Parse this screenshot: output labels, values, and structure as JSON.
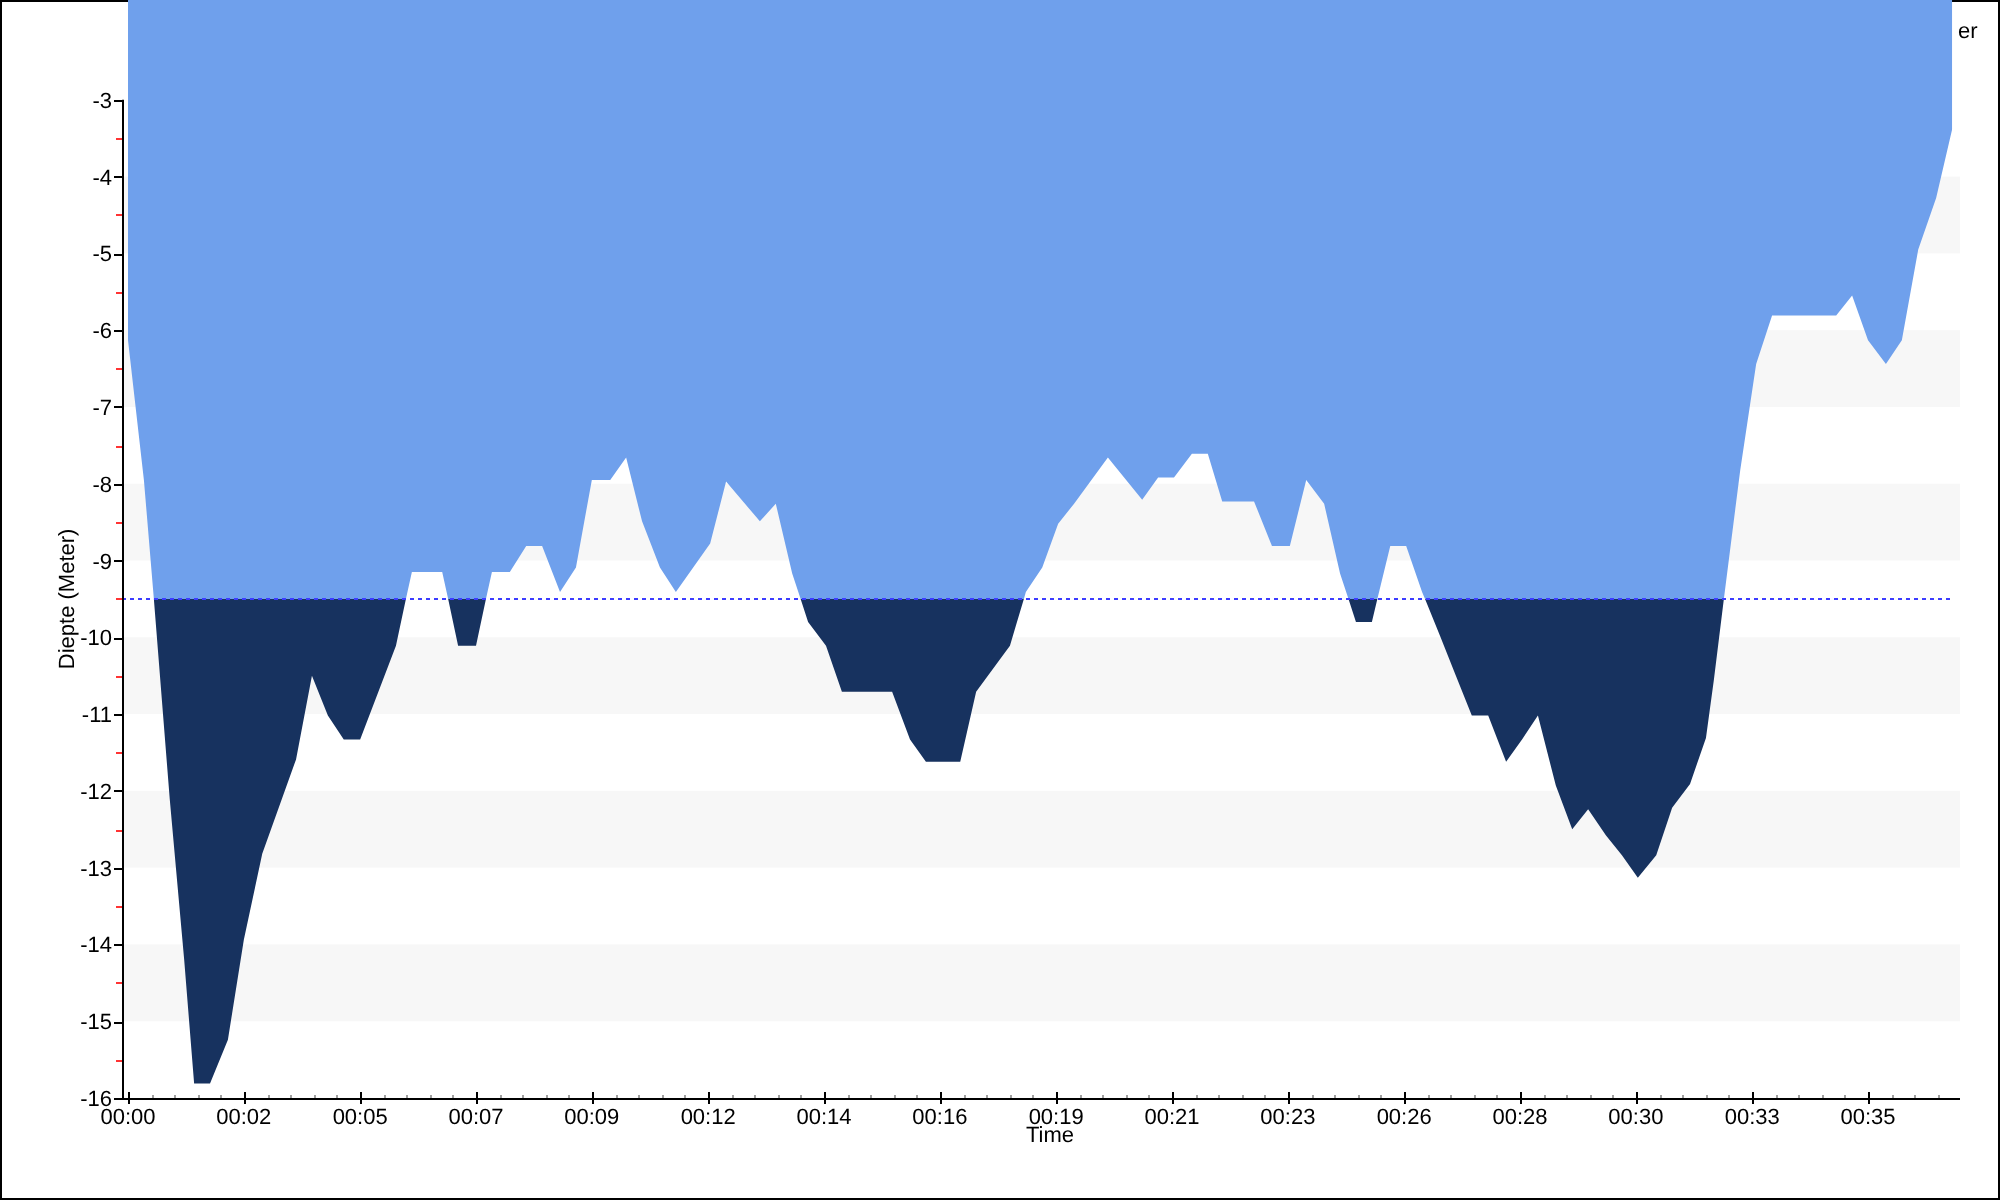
{
  "chart": {
    "legend_label": "er",
    "chart_data": {
      "type": "area",
      "xlabel": "Time",
      "ylabel": "Diepte (Meter)",
      "x": [
        0,
        0.32,
        0.52,
        0.84,
        1.13,
        1.33,
        1.65,
        2.01,
        2.33,
        2.7,
        3.38,
        3.7,
        4.02,
        4.34,
        4.67,
        5.39,
        5.59,
        5.71,
        6.32,
        6.44,
        6.64,
        7,
        7.2,
        7.32,
        7.68,
        8.01,
        8.33,
        8.69,
        9.01,
        9.33,
        9.7,
        10.02,
        10.34,
        10.7,
        11.02,
        11.71,
        12.03,
        12.71,
        13.03,
        13.36,
        13.53,
        13.68,
        14.04,
        14.36,
        15.37,
        15.73,
        16.05,
        16.74,
        17.06,
        17.74,
        18.02,
        18.06,
        18.39,
        18.71,
        19.03,
        19.71,
        20.4,
        20.72,
        21.04,
        21.4,
        21.72,
        22.01,
        22.65,
        23.01,
        23.37,
        23.7,
        24.06,
        24.38,
        24.55,
        24.7,
        25.02,
        25.13,
        25.39,
        25.71,
        26.03,
        26.09,
        26.39,
        26.71,
        27.03,
        27.36,
        27.72,
        28.04,
        28.36,
        28.72,
        29.05,
        29.37,
        29.73,
        30.05,
        30.37,
        30.74,
        31.06,
        31.42,
        31.74,
        31.9,
        32.1,
        32.43,
        32.75,
        33.07,
        34.36,
        34.68,
        35,
        35.36,
        35.68,
        36.01,
        36.37,
        36.69
      ],
      "series": [
        {
          "color": "#6fa0ec",
          "values": [
            -6.13,
            -7.95,
            -9.5,
            -9.5,
            -9.5,
            -9.5,
            -9.5,
            -9.5,
            -9.5,
            -9.5,
            -9.5,
            -9.5,
            -9.5,
            -9.5,
            -9.5,
            -9.5,
            -9.5,
            -9.15,
            -9.15,
            -9.5,
            -9.5,
            -9.5,
            -9.5,
            -9.15,
            -9.15,
            -8.81,
            -8.81,
            -9.41,
            -9.09,
            -7.95,
            -7.95,
            -7.66,
            -8.49,
            -9.09,
            -9.41,
            -8.78,
            -7.97,
            -8.49,
            -8.26,
            -9.17,
            -9.5,
            -9.5,
            -9.5,
            -9.5,
            -9.5,
            -9.5,
            -9.5,
            -9.5,
            -9.5,
            -9.5,
            -9.5,
            -9.41,
            -9.09,
            -8.52,
            -8.26,
            -7.66,
            -8.21,
            -7.92,
            -7.92,
            -7.61,
            -7.61,
            -8.23,
            -8.23,
            -8.81,
            -8.81,
            -7.95,
            -8.26,
            -9.17,
            -9.5,
            -9.5,
            -9.5,
            -9.5,
            -8.81,
            -8.81,
            -9.41,
            -9.5,
            -9.5,
            -9.5,
            -9.5,
            -9.5,
            -9.5,
            -9.5,
            -9.5,
            -9.5,
            -9.5,
            -9.5,
            -9.5,
            -9.5,
            -9.5,
            -9.5,
            -9.5,
            -9.5,
            -9.5,
            -9.5,
            -9.5,
            -7.82,
            -6.44,
            -5.81,
            -5.81,
            -5.55,
            -6.13,
            -6.44,
            -6.13,
            -4.95,
            -4.28,
            -3.39
          ]
        },
        {
          "color": "#17325f",
          "values": [
            null,
            null,
            -9.5,
            -12.11,
            -14.2,
            -15.81,
            -15.81,
            -15.24,
            -13.94,
            -12.82,
            -11.59,
            -10.5,
            -11.02,
            -11.33,
            -11.33,
            -10.11,
            -9.5,
            null,
            null,
            -9.5,
            -10.11,
            -10.11,
            -9.5,
            null,
            null,
            null,
            null,
            null,
            null,
            null,
            null,
            null,
            null,
            null,
            null,
            null,
            null,
            null,
            null,
            null,
            -9.5,
            -9.8,
            -10.11,
            -10.71,
            -10.71,
            -11.33,
            -11.62,
            -11.62,
            -10.71,
            -10.11,
            -9.5,
            null,
            null,
            null,
            null,
            null,
            null,
            null,
            null,
            null,
            null,
            null,
            null,
            null,
            null,
            null,
            null,
            null,
            -9.5,
            -9.8,
            -9.8,
            -9.5,
            null,
            null,
            null,
            -9.5,
            -9.98,
            -10.5,
            -11.02,
            -11.02,
            -11.62,
            -11.33,
            -11.02,
            -11.93,
            -12.5,
            -12.24,
            -12.58,
            -12.84,
            -13.13,
            -12.84,
            -12.22,
            -11.91,
            -11.31,
            -10.55,
            -9.5,
            null,
            null,
            null,
            null,
            null,
            null,
            null,
            null,
            null,
            null,
            null
          ]
        }
      ],
      "xlim": [
        0,
        36.85
      ],
      "ylim": [
        -16,
        -1.7
      ],
      "xticks": [
        {
          "value": 0,
          "label": "00:00"
        },
        {
          "value": 2.33,
          "label": "00:02"
        },
        {
          "value": 4.67,
          "label": "00:05"
        },
        {
          "value": 7,
          "label": "00:07"
        },
        {
          "value": 9.33,
          "label": "00:09"
        },
        {
          "value": 11.67,
          "label": "00:12"
        },
        {
          "value": 14,
          "label": "00:14"
        },
        {
          "value": 16.33,
          "label": "00:16"
        },
        {
          "value": 18.67,
          "label": "00:19"
        },
        {
          "value": 21,
          "label": "00:21"
        },
        {
          "value": 23.33,
          "label": "00:23"
        },
        {
          "value": 25.67,
          "label": "00:26"
        },
        {
          "value": 28,
          "label": "00:28"
        },
        {
          "value": 30.33,
          "label": "00:30"
        },
        {
          "value": 32.67,
          "label": "00:33"
        },
        {
          "value": 35,
          "label": "00:35"
        }
      ],
      "yticks": [
        -3,
        -4,
        -5,
        -6,
        -7,
        -8,
        -9,
        -10,
        -11,
        -12,
        -13,
        -14,
        -15,
        -16
      ],
      "ref_lines": [
        {
          "axis": "y",
          "value": -9.5,
          "color": "#3c3cff"
        }
      ]
    }
  }
}
